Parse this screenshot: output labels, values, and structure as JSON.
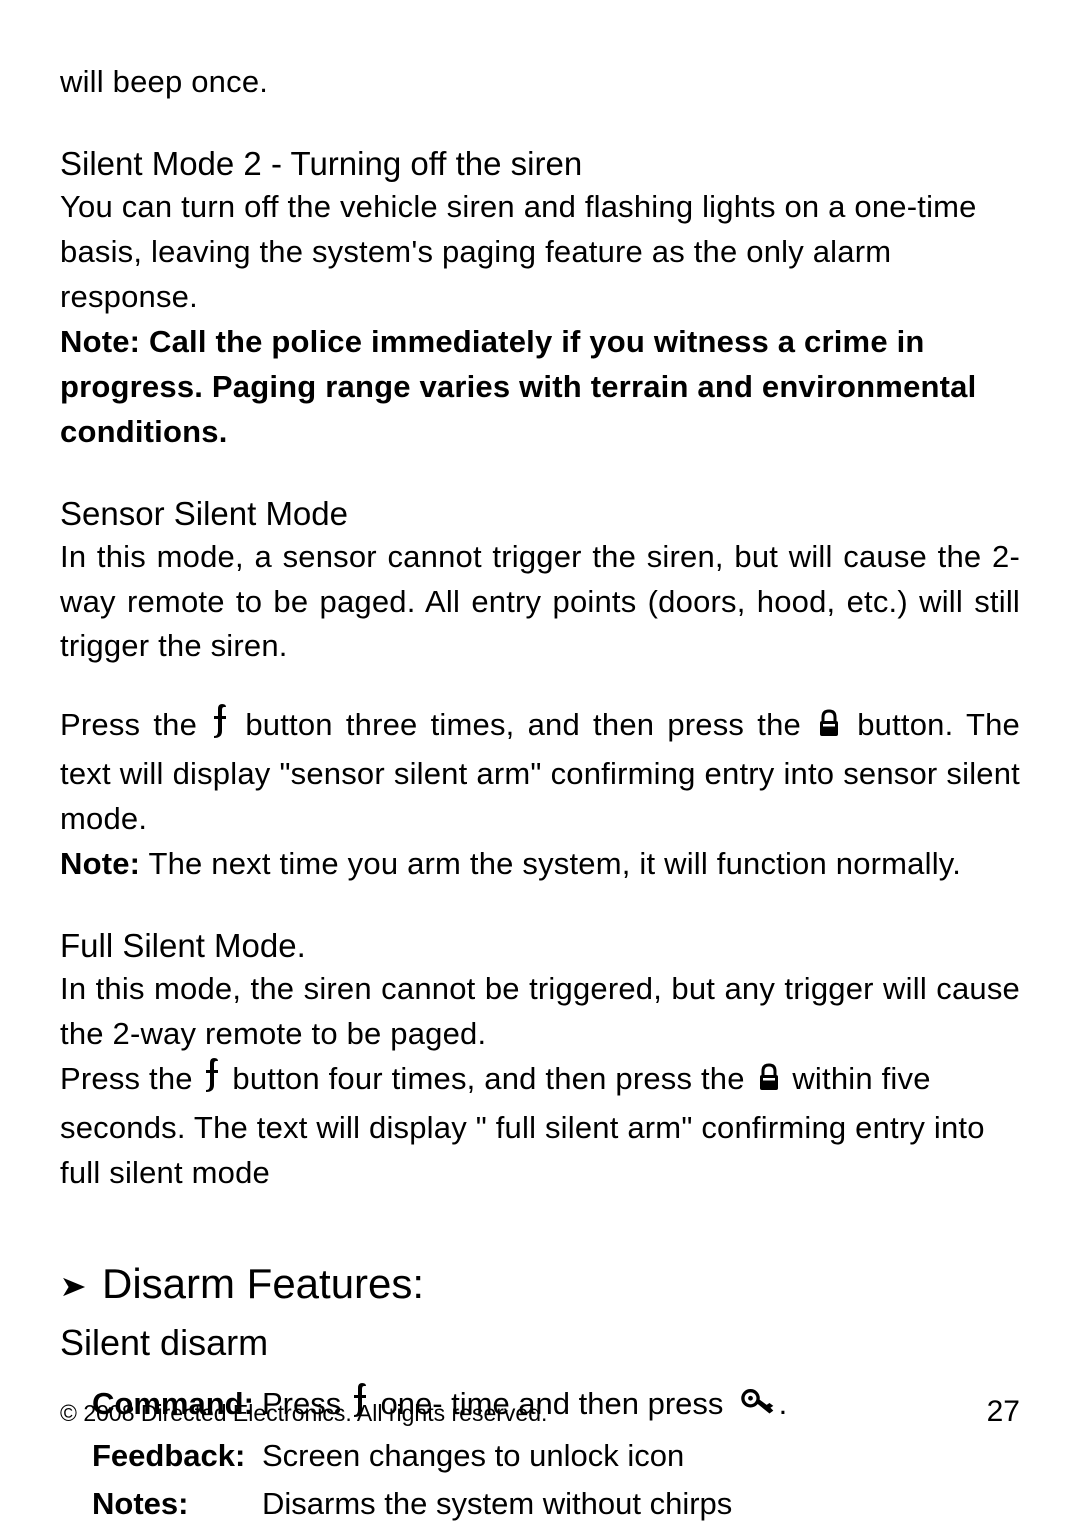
{
  "intro_fragment": "will beep once.",
  "s1": {
    "heading": "Silent Mode 2 - Turning off the siren",
    "body": "You can turn off the vehicle siren and flashing lights on a one-time basis, leaving the system's paging feature as the only alarm response.",
    "note_bold": "Note: Call the police immediately if you witness a crime in progress. Paging range varies with terrain and environmental conditions."
  },
  "s2": {
    "heading": "Sensor Silent Mode",
    "body1": "In this mode, a sensor cannot trigger the siren, but will cause the 2- way remote to be paged. All entry points (doors, hood, etc.) will still trigger the siren.",
    "p2_a": "Press the ",
    "p2_b": " button three times, and then press the ",
    "p2_c": " button. The text will display \"sensor silent arm\" confirming entry into sensor silent mode.",
    "note_label": "Note:",
    "note_text": " The next time you arm the system, it will function normally."
  },
  "s3": {
    "heading": "Full Silent Mode.",
    "body1": "In this mode, the siren cannot be triggered, but any trigger will cause the 2-way remote to be paged.",
    "p2_a": "Press the ",
    "p2_b": " button four times, and then press the ",
    "p2_c": " within five seconds. The text will display \" full silent arm\" confirming entry into full silent mode"
  },
  "section_title": "Disarm Features:",
  "sub": {
    "heading": "Silent disarm",
    "command_label": "Command",
    "command_a": "Press ",
    "command_b": " one- time and then press ",
    "command_c": ".",
    "feedback_label": "Feedback",
    "feedback_text": "Screen changes to unlock icon",
    "notes_label": "Notes",
    "notes_text": "Disarms the system without chirps"
  },
  "footer": {
    "copyright": "© 2008 Directed Electronics. All rights reserved.",
    "page": "27"
  }
}
